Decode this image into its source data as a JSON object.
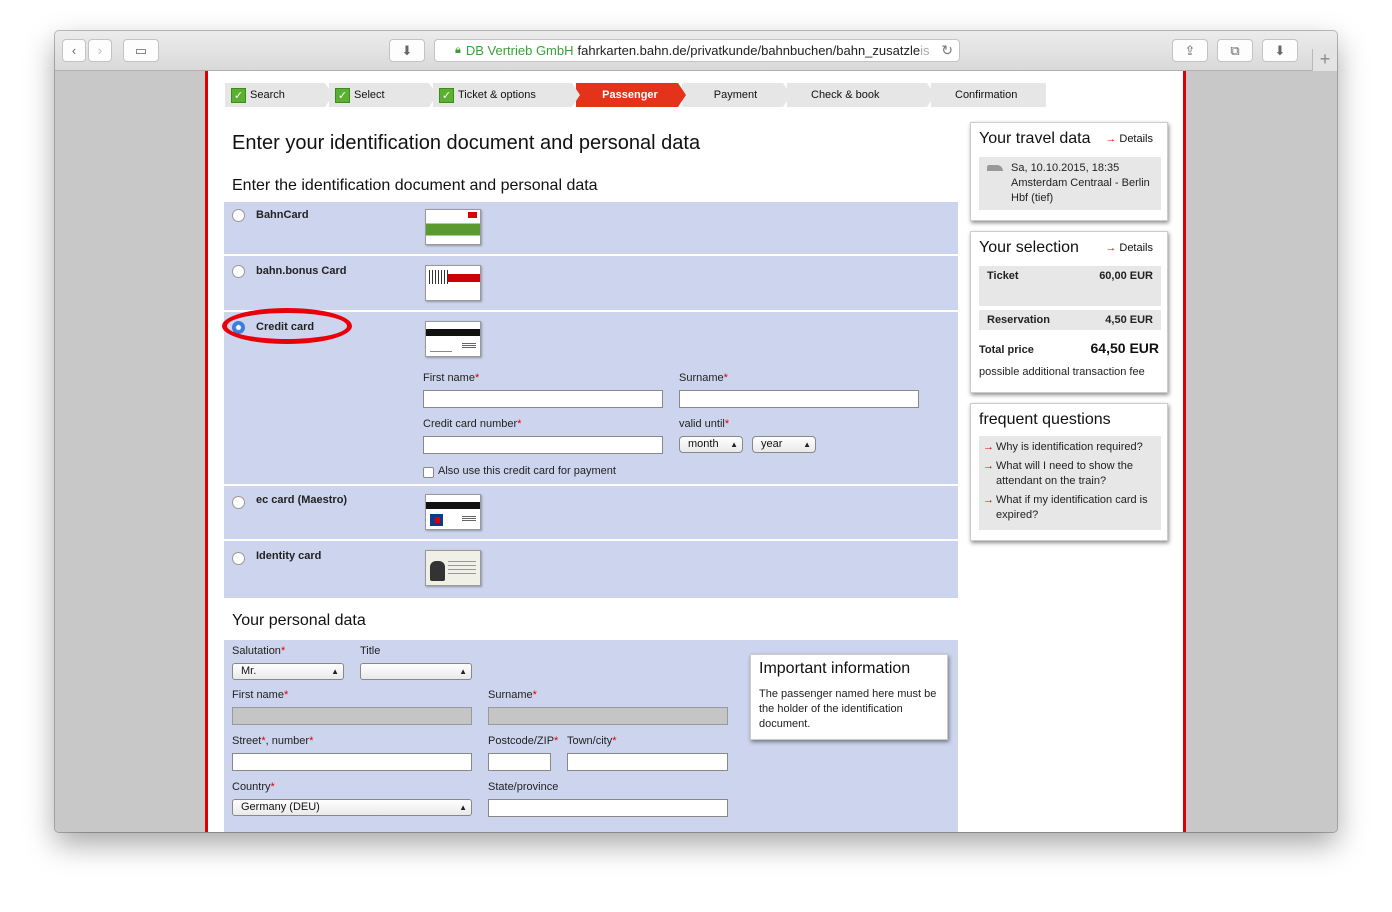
{
  "browser": {
    "org": "DB Vertrieb GmbH",
    "url_main": "fahrkarten.bahn.de/privatkunde/bahnbuchen/bahn_zusatzle",
    "url_fade": "is",
    "icons": [
      "back-icon",
      "forward-icon",
      "sidebar-icon",
      "download-icon",
      "lock-icon",
      "reload-icon",
      "share-icon",
      "tabs-icon",
      "downloads-icon",
      "new-tab-icon"
    ]
  },
  "steps": [
    {
      "label": "Search",
      "state": "done"
    },
    {
      "label": "Select",
      "state": "done"
    },
    {
      "label": "Ticket & options",
      "state": "done"
    },
    {
      "label": "Passenger",
      "state": "active"
    },
    {
      "label": "Payment",
      "state": "todo"
    },
    {
      "label": "Check & book",
      "state": "todo"
    },
    {
      "label": "Confirmation",
      "state": "todo"
    }
  ],
  "main": {
    "title": "Enter your identification document and personal data",
    "subtitle": "Enter the identification document and personal data",
    "options": {
      "bahncard": "BahnCard",
      "bonus": "bahn.bonus Card",
      "credit": "Credit card",
      "ec": "ec card (Maestro)",
      "identity": "Identity card"
    },
    "selected_option": "Credit card",
    "card_form": {
      "first_name": "First name",
      "surname": "Surname",
      "card_number": "Credit card number",
      "valid_until": "valid until",
      "month": "month",
      "year": "year",
      "also_use": "Also use this credit card for payment",
      "req": "*"
    },
    "personal": {
      "title": "Your personal data",
      "salutation": "Salutation",
      "salutation_value": "Mr.",
      "title_label": "Title",
      "first_name": "First name",
      "surname": "Surname",
      "street": "Street",
      "number": ", number",
      "postcode": "Postcode/ZIP",
      "town": "Town/city",
      "country": "Country",
      "country_value": "Germany (DEU)",
      "state": "State/province"
    },
    "important": {
      "title": "Important information",
      "text": "The passenger named here must be the holder of the identification document."
    }
  },
  "sidebar": {
    "travel": {
      "title": "Your travel data",
      "details": "Details",
      "date": "Sa, 10.10.2015, 18:35",
      "route": "Amsterdam Centraal - Berlin Hbf (tief)"
    },
    "selection": {
      "title": "Your selection",
      "details": "Details",
      "ticket_label": "Ticket",
      "ticket_price": "60,00 EUR",
      "res_label": "Reservation",
      "res_price": "4,50 EUR",
      "total_label": "Total price",
      "total_price": "64,50 EUR",
      "fee": "possible additional transaction fee"
    },
    "faq": {
      "title": "frequent questions",
      "q1": "Why is identification required?",
      "q2": "What will I need to show the attendant on the train?",
      "q3": "What if my identification card is expired?"
    }
  },
  "colors": {
    "accent": "#e4321b",
    "panel": "#cdd5ee",
    "highlight_ellipse": "#e8000b"
  }
}
